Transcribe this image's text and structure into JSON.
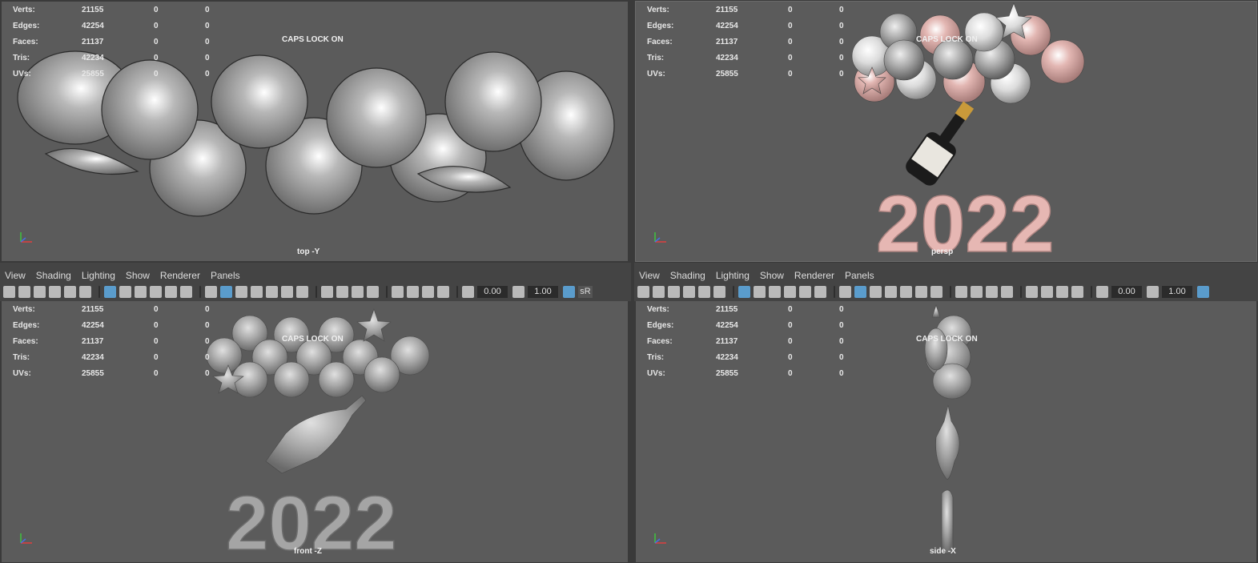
{
  "hud": {
    "rows": [
      {
        "label": "Verts:",
        "v1": "21155",
        "v2": "0",
        "v3": "0"
      },
      {
        "label": "Edges:",
        "v1": "42254",
        "v2": "0",
        "v3": "0"
      },
      {
        "label": "Faces:",
        "v1": "21137",
        "v2": "0",
        "v3": "0"
      },
      {
        "label": "Tris:",
        "v1": "42234",
        "v2": "0",
        "v3": "0"
      },
      {
        "label": "UVs:",
        "v1": "25855",
        "v2": "0",
        "v3": "0"
      }
    ],
    "caps_lock": "CAPS LOCK ON"
  },
  "viewports": {
    "top_left": {
      "camera": "top -Y"
    },
    "top_right": {
      "camera": "persp"
    },
    "bottom_left": {
      "camera": "front -Z"
    },
    "bottom_right": {
      "camera": "side -X"
    }
  },
  "menu": {
    "left": [
      "View",
      "Shading",
      "Lighting",
      "Show",
      "Renderer",
      "Panels"
    ],
    "right": [
      "View",
      "Shading",
      "Lighting",
      "Show",
      "Renderer",
      "Panels"
    ]
  },
  "toolbar": {
    "exposure": "0.00",
    "gamma": "1.00",
    "color_mgmt": "sR"
  },
  "scene": {
    "year_text": "2022"
  },
  "colors": {
    "viewport_bg": "#5b5b5b",
    "balloon_grey": "#9a9a9a",
    "balloon_pink": "#e8b8b4",
    "accent": "#5a9ccc"
  }
}
